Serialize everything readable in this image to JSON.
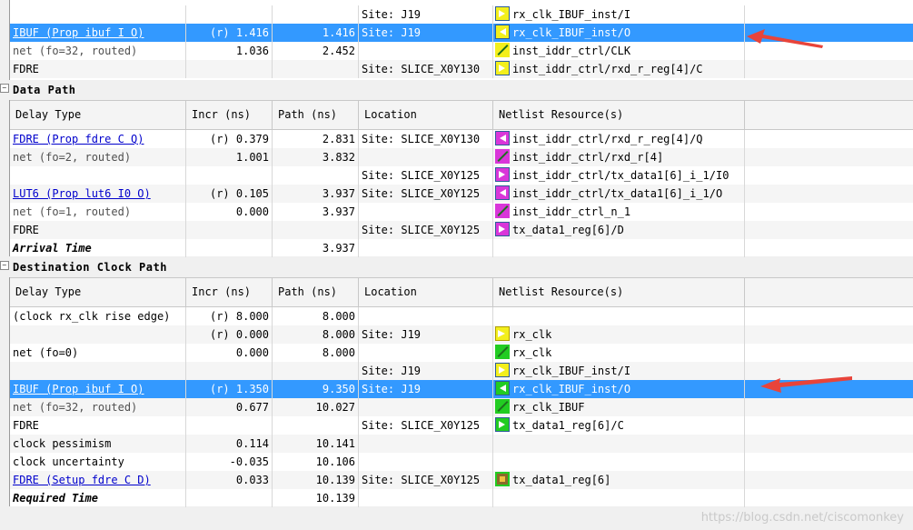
{
  "top_rows": [
    {
      "c1": "",
      "c2": "",
      "c3": "",
      "c4": "Site: J19",
      "c5": "rx_clk_IBUF_inst/I",
      "icon": "pin",
      "color": "y"
    },
    {
      "c1": "IBUF (Prop ibuf I O)",
      "c2": "(r) 1.416",
      "c3": "1.416",
      "c4": "Site: J19",
      "c5": "rx_clk_IBUF_inst/O",
      "icon": "pin-out",
      "color": "y",
      "selected": true,
      "link": true
    },
    {
      "c1": "net (fo=32, routed)",
      "c2": "1.036",
      "c3": "2.452",
      "c4": "",
      "c5": "inst_iddr_ctrl/CLK",
      "icon": "net",
      "color": "y",
      "muted": true
    },
    {
      "c1": "FDRE",
      "c2": "",
      "c3": "",
      "c4": "Site: SLICE_X0Y130",
      "c5": "inst_iddr_ctrl/rxd_r_reg[4]/C",
      "icon": "pin",
      "color": "y"
    }
  ],
  "data_path": {
    "title": "Data Path",
    "headers": [
      "Delay Type",
      "Incr (ns)",
      "Path (ns)",
      "Location",
      "Netlist Resource(s)"
    ],
    "rows": [
      {
        "c1": "FDRE (Prop fdre C Q)",
        "c2": "(r) 0.379",
        "c3": "2.831",
        "c4": "Site: SLICE_X0Y130",
        "c5": "inst_iddr_ctrl/rxd_r_reg[4]/Q",
        "icon": "pin-out",
        "color": "m",
        "link": true
      },
      {
        "c1": "net (fo=2, routed)",
        "c2": "1.001",
        "c3": "3.832",
        "c4": "",
        "c5": "inst_iddr_ctrl/rxd_r[4]",
        "icon": "net",
        "color": "m",
        "muted": true
      },
      {
        "c1": "",
        "c2": "",
        "c3": "",
        "c4": "Site: SLICE_X0Y125",
        "c5": "inst_iddr_ctrl/tx_data1[6]_i_1/I0",
        "icon": "pin",
        "color": "m"
      },
      {
        "c1": "LUT6 (Prop lut6 I0 O)",
        "c2": "(r) 0.105",
        "c3": "3.937",
        "c4": "Site: SLICE_X0Y125",
        "c5": "inst_iddr_ctrl/tx_data1[6]_i_1/O",
        "icon": "pin-out",
        "color": "m",
        "link": true
      },
      {
        "c1": "net (fo=1, routed)",
        "c2": "0.000",
        "c3": "3.937",
        "c4": "",
        "c5": "inst_iddr_ctrl_n_1",
        "icon": "net",
        "color": "m",
        "muted": true
      },
      {
        "c1": "FDRE",
        "c2": "",
        "c3": "",
        "c4": "Site: SLICE_X0Y125",
        "c5": "tx_data1_reg[6]/D",
        "icon": "pin",
        "color": "m"
      },
      {
        "c1": "Arrival Time",
        "c2": "",
        "c3": "3.937",
        "c4": "",
        "c5": "",
        "icon": "",
        "bold": true
      }
    ]
  },
  "dest_path": {
    "title": "Destination Clock Path",
    "headers": [
      "Delay Type",
      "Incr (ns)",
      "Path (ns)",
      "Location",
      "Netlist Resource(s)"
    ],
    "rows": [
      {
        "c1": "(clock rx_clk rise edge)",
        "c2": "(r) 8.000",
        "c3": "8.000",
        "c4": "",
        "c5": "",
        "icon": ""
      },
      {
        "c1": "",
        "c2": "(r) 0.000",
        "c3": "8.000",
        "c4": "Site: J19",
        "c5": "rx_clk",
        "icon": "port"
      },
      {
        "c1": "net (fo=0)",
        "c2": "0.000",
        "c3": "8.000",
        "c4": "",
        "c5": "rx_clk",
        "icon": "net",
        "color": "g"
      },
      {
        "c1": "",
        "c2": "",
        "c3": "",
        "c4": "Site: J19",
        "c5": "rx_clk_IBUF_inst/I",
        "icon": "pin",
        "color": "y"
      },
      {
        "c1": "IBUF (Prop ibuf I O)",
        "c2": "(r) 1.350",
        "c3": "9.350",
        "c4": "Site: J19",
        "c5": "rx_clk_IBUF_inst/O",
        "icon": "pin-out",
        "color": "g",
        "selected": true,
        "link": true
      },
      {
        "c1": "net (fo=32, routed)",
        "c2": "0.677",
        "c3": "10.027",
        "c4": "",
        "c5": "rx_clk_IBUF",
        "icon": "net",
        "color": "g",
        "muted": true
      },
      {
        "c1": "FDRE",
        "c2": "",
        "c3": "",
        "c4": "Site: SLICE_X0Y125",
        "c5": "tx_data1_reg[6]/C",
        "icon": "pin",
        "color": "g"
      },
      {
        "c1": "clock pessimism",
        "c2": "0.114",
        "c3": "10.141",
        "c4": "",
        "c5": "",
        "icon": ""
      },
      {
        "c1": "clock uncertainty",
        "c2": "-0.035",
        "c3": "10.106",
        "c4": "",
        "c5": "",
        "icon": ""
      },
      {
        "c1": "FDRE (Setup fdre C D)",
        "c2": "0.033",
        "c3": "10.139",
        "c4": "Site: SLICE_X0Y125",
        "c5": "tx_data1_reg[6]",
        "icon": "cell",
        "link": true
      },
      {
        "c1": "Required Time",
        "c2": "",
        "c3": "10.139",
        "c4": "",
        "c5": "",
        "icon": "",
        "bold": true
      }
    ]
  },
  "watermark": "https://blog.csdn.net/ciscomonkey",
  "colors": {
    "selected": "#3399ff",
    "link": "#0000cc",
    "arrow": "#e8443a"
  }
}
